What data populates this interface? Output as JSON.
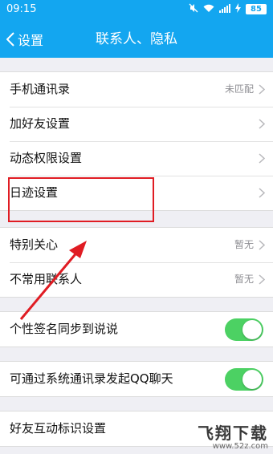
{
  "status_bar": {
    "time": "09:15",
    "battery": "85"
  },
  "header": {
    "back_label": "设置",
    "title": "联系人、隐私"
  },
  "sections": [
    [
      {
        "label": "手机通讯录",
        "value": "未匹配",
        "type": "link"
      },
      {
        "label": "加好友设置",
        "type": "link"
      },
      {
        "label": "动态权限设置",
        "type": "link"
      },
      {
        "label": "日迹设置",
        "type": "link"
      }
    ],
    [
      {
        "label": "特别关心",
        "value": "暂无",
        "type": "link"
      },
      {
        "label": "不常用联系人",
        "value": "暂无",
        "type": "link"
      }
    ],
    [
      {
        "label": "个性签名同步到说说",
        "type": "toggle",
        "on": true
      }
    ],
    [
      {
        "label": "可通过系统通讯录发起QQ聊天",
        "type": "toggle",
        "on": true
      }
    ],
    [
      {
        "label": "好友互动标识设置",
        "type": "link"
      }
    ]
  ],
  "watermark": {
    "text": "飞翔下载",
    "url": "www.52z.com"
  },
  "colors": {
    "accent": "#13a6f0",
    "toggle_on": "#4cd163",
    "annotation": "#e01c23"
  }
}
